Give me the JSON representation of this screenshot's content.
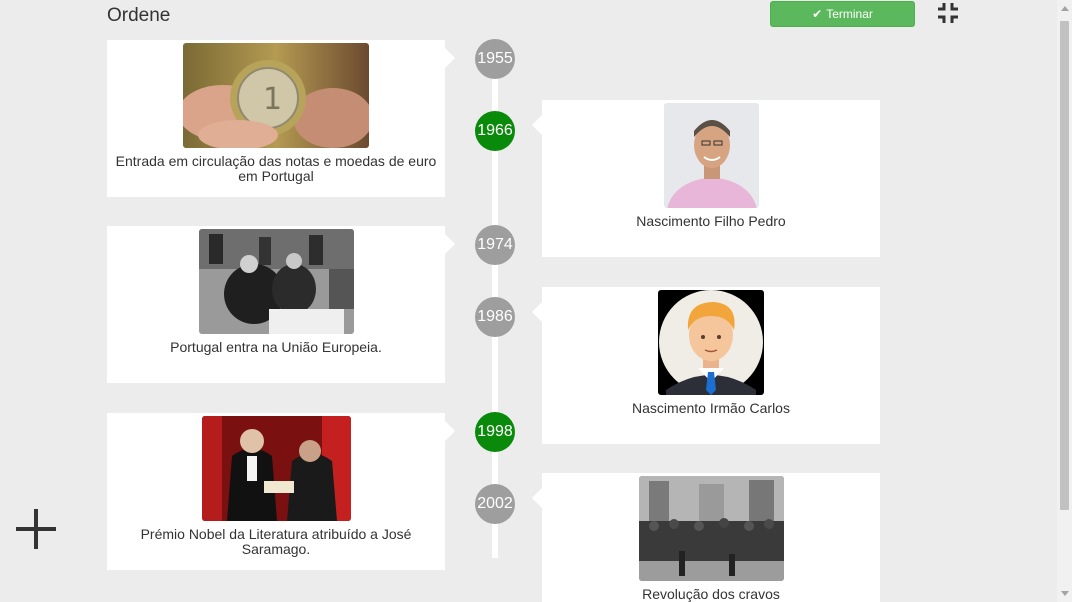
{
  "header": {
    "title": "Ordene",
    "finish_label": "Terminar",
    "collapse_icon": "compress-icon"
  },
  "events": [
    {
      "caption": "Entrada em circulação das notas e moedas de euro em Portugal",
      "image": "euro-coin-photo"
    },
    {
      "caption": "Nascimento Filho Pedro",
      "image": "man-portrait-photo"
    },
    {
      "caption": "Portugal entra na União Europeia.",
      "image": "treaty-signing-photo"
    },
    {
      "caption": "Nascimento Irmão Carlos",
      "image": "cartoon-avatar-illustration"
    },
    {
      "caption": "Prémio Nobel da Literatura atribuído a José Saramago.",
      "image": "nobel-ceremony-photo"
    },
    {
      "caption": "Revolução dos cravos",
      "image": "crowd-revolution-photo"
    }
  ],
  "years": [
    {
      "label": "1955",
      "status": "neutral"
    },
    {
      "label": "1966",
      "status": "correct"
    },
    {
      "label": "1974",
      "status": "neutral"
    },
    {
      "label": "1986",
      "status": "neutral"
    },
    {
      "label": "1998",
      "status": "correct"
    },
    {
      "label": "2002",
      "status": "neutral"
    }
  ],
  "colors": {
    "finish_button": "#5cb85c",
    "year_neutral": "#9e9e9e",
    "year_correct": "#0a8a0a",
    "background": "#ececec"
  },
  "add_icon": "plus-icon"
}
